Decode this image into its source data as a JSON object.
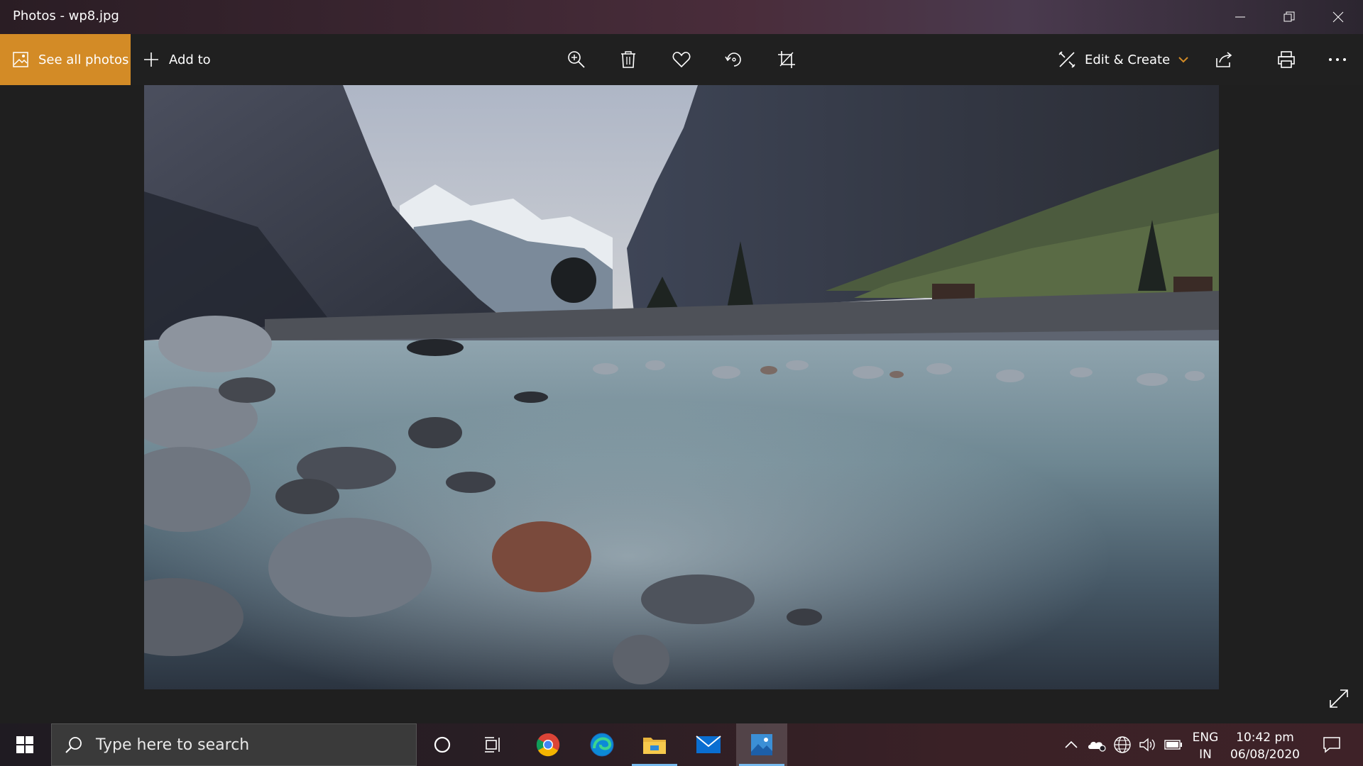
{
  "window": {
    "title": "Photos - wp8.jpg"
  },
  "toolbar": {
    "see_all_label": "See all photos",
    "add_to_label": "Add to",
    "edit_create_label": "Edit & Create",
    "accent_color": "#d38b26"
  },
  "photo": {
    "filename": "wp8.jpg"
  },
  "taskbar": {
    "search_placeholder": "Type here to search",
    "lang_line1": "ENG",
    "lang_line2": "IN",
    "time": "10:42 pm",
    "date": "06/08/2020"
  },
  "icons": {
    "toolbar": [
      "zoom-icon",
      "delete-icon",
      "heart-icon",
      "rotate-icon",
      "crop-icon",
      "edit-create-icon",
      "share-icon",
      "print-icon",
      "more-icon"
    ],
    "taskbar": [
      "windows-start-icon",
      "search-icon",
      "cortana-icon",
      "task-view-icon",
      "chrome-icon",
      "edge-icon",
      "file-explorer-icon",
      "mail-icon",
      "photos-icon"
    ],
    "tray": [
      "chevron-up-icon",
      "onedrive-icon",
      "network-icon",
      "volume-icon",
      "battery-icon",
      "notification-icon"
    ]
  }
}
